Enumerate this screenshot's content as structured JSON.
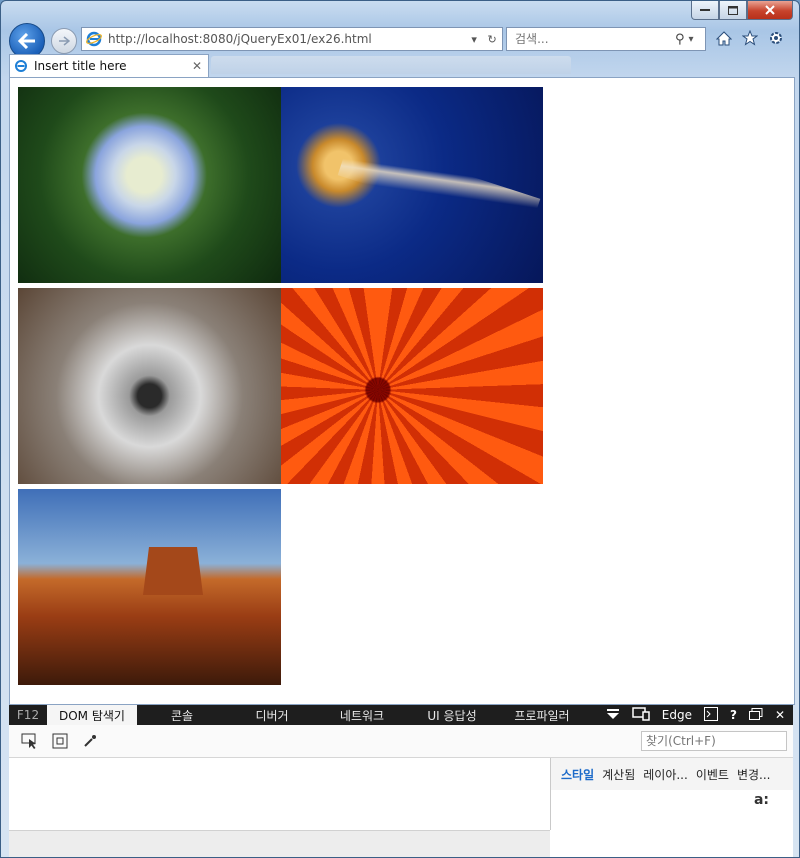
{
  "browser": {
    "address": "http://localhost:8080/jQueryEx01/ex26.html",
    "search_placeholder": "검색...",
    "tab_title": "Insert title here"
  },
  "devtools": {
    "f12_label": "F12",
    "tabs": [
      {
        "label": "DOM 탐색기",
        "active": true
      },
      {
        "label": "콘솔",
        "active": false
      },
      {
        "label": "디버거",
        "active": false
      },
      {
        "label": "네트워크",
        "active": false
      },
      {
        "label": "UI 응답성",
        "active": false
      },
      {
        "label": "프로파일러",
        "active": false
      }
    ],
    "emulation_mode": "Edge",
    "find_placeholder": "찾기(Ctrl+F)",
    "side_tabs": [
      {
        "label": "스타일",
        "active": true
      },
      {
        "label": "계산됨",
        "active": false
      },
      {
        "label": "레이아...",
        "active": false
      },
      {
        "label": "이벤트",
        "active": false
      },
      {
        "label": "변경...",
        "active": false
      }
    ],
    "font_size_glyph": "a:"
  },
  "photos": [
    {
      "name": "hydrangea"
    },
    {
      "name": "jellyfish"
    },
    {
      "name": "koala"
    },
    {
      "name": "chrysanthemum"
    },
    {
      "name": "desert"
    }
  ],
  "colors": {
    "ie_blue": "#1a5fb8",
    "close_red": "#c7432c",
    "active_side_tab": "#1b6ac9"
  }
}
